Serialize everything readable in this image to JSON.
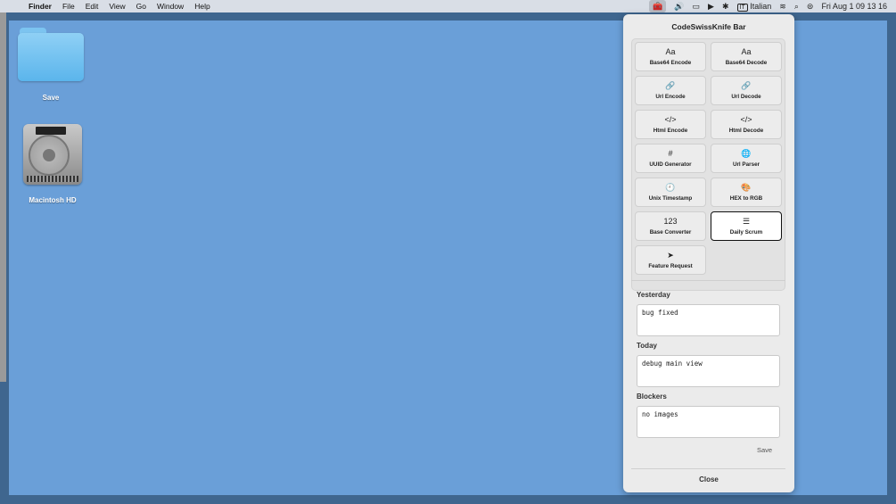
{
  "menubar": {
    "app_name": "Finder",
    "menus": [
      "File",
      "Edit",
      "View",
      "Go",
      "Window",
      "Help"
    ],
    "language": "Italian",
    "language_badge": "IT",
    "datetime": "Fri Aug 1  09 13 16"
  },
  "desktop": {
    "items": [
      {
        "label": "Save",
        "icon": "folder-icon"
      },
      {
        "label": "Macintosh HD",
        "icon": "hard-drive-icon"
      }
    ]
  },
  "panel": {
    "title": "CodeSwissKnife Bar",
    "tools": [
      {
        "label": "Base64 Encode",
        "icon": "Aa"
      },
      {
        "label": "Base64 Decode",
        "icon": "Aa"
      },
      {
        "label": "Url Encode",
        "icon": "🔗"
      },
      {
        "label": "Url Decode",
        "icon": "🔗"
      },
      {
        "label": "Html Encode",
        "icon": "</>"
      },
      {
        "label": "Html Decode",
        "icon": "</>"
      },
      {
        "label": "UUID Generator",
        "icon": "#"
      },
      {
        "label": "Url Parser",
        "icon": "🌐"
      },
      {
        "label": "Unix Timestamp",
        "icon": "🕘"
      },
      {
        "label": "HEX to RGB",
        "icon": "🎨"
      },
      {
        "label": "Base Converter",
        "icon": "123"
      },
      {
        "label": "Daily Scrum",
        "icon": "☰"
      },
      {
        "label": "Feature Request",
        "icon": "➤"
      }
    ],
    "selected_tool": "Daily Scrum",
    "yesterday_label": "Yesterday",
    "yesterday_value": "bug fixed",
    "today_label": "Today",
    "today_value": "debug main view",
    "blockers_label": "Blockers",
    "blockers_value": "no images",
    "save_label": "Save",
    "close_label": "Close"
  }
}
